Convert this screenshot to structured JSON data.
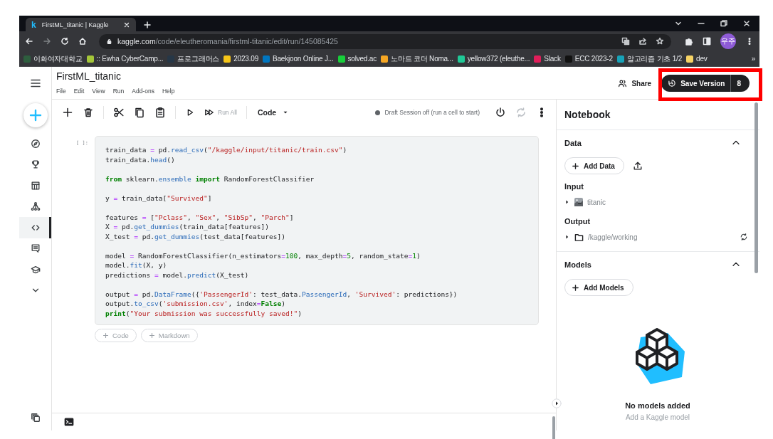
{
  "browser": {
    "tab": {
      "favicon": "k",
      "title": "FirstML_titanic | Kaggle"
    },
    "address": {
      "host": "kaggle.com",
      "path": "/code/eleutheromania/firstml-titanic/edit/run/145085425"
    },
    "profile": "우주",
    "bookmarks": [
      {
        "label": "이화여자대학교",
        "color": "#2e5e3e"
      },
      {
        "label": ":: Ewha CyberCamp...",
        "color": "#a4c639"
      },
      {
        "label": "프로그래머스",
        "color": "#263747"
      },
      {
        "label": "2023.09",
        "color": "#f5c518"
      },
      {
        "label": "Baekjoon Online J...",
        "color": "#0076c0"
      },
      {
        "label": "solved.ac",
        "color": "#17ce3a"
      },
      {
        "label": "노마드 코더 Noma...",
        "color": "#f5a623"
      },
      {
        "label": "yellow372 (eleuthe...",
        "color": "#20c997"
      },
      {
        "label": "Slack",
        "color": "#e01e5a"
      },
      {
        "label": "ECC 2023-2",
        "color": "#111111"
      },
      {
        "label": "알고리즘 기초 1/2",
        "color": "#17a2b8"
      },
      {
        "label": "dev",
        "color": "#f6d365"
      }
    ],
    "more": "»"
  },
  "header": {
    "title": "FirstML_titanic",
    "menu": [
      "File",
      "Edit",
      "View",
      "Run",
      "Add-ons",
      "Help"
    ],
    "share": "Share",
    "save_version": {
      "label": "Save Version",
      "count": "8",
      "highlighted": true
    }
  },
  "sidebar": {
    "items": [
      {
        "selected": false
      },
      {
        "selected": false
      },
      {
        "selected": false
      },
      {
        "selected": false
      },
      {
        "selected": true
      },
      {
        "selected": false
      },
      {
        "selected": false
      },
      {
        "selected": false
      }
    ]
  },
  "toolbar": {
    "run_all": "Run All",
    "cell_type": "Code",
    "session": {
      "text": "Draft Session off (run a cell to start)",
      "active": false
    }
  },
  "cell": {
    "prompt": "[ ]:",
    "blocks": [
      [
        [
          {
            "text": "train_data ",
            "kind": "plain"
          },
          {
            "text": "=",
            "kind": "op"
          },
          {
            "text": " pd.",
            "kind": "plain"
          },
          {
            "text": "read_csv",
            "kind": "fn"
          },
          {
            "text": "(",
            "kind": "plain"
          },
          {
            "text": "\"/kaggle/input/titanic/train.csv\"",
            "kind": "str"
          },
          {
            "text": ")",
            "kind": "plain"
          }
        ],
        [
          {
            "text": "train_data.",
            "kind": "plain"
          },
          {
            "text": "head",
            "kind": "fn"
          },
          {
            "text": "()",
            "kind": "plain"
          }
        ]
      ],
      [
        [
          {
            "text": "from",
            "kind": "kw"
          },
          {
            "text": " sklearn.",
            "kind": "plain"
          },
          {
            "text": "ensemble",
            "kind": "fn"
          },
          {
            "text": " import",
            "kind": "kw"
          },
          {
            "text": " RandomForestClassifier",
            "kind": "plain"
          }
        ]
      ],
      [
        [
          {
            "text": "y ",
            "kind": "plain"
          },
          {
            "text": "=",
            "kind": "op"
          },
          {
            "text": " train_data[",
            "kind": "plain"
          },
          {
            "text": "\"Survived\"",
            "kind": "str"
          },
          {
            "text": "]",
            "kind": "plain"
          }
        ]
      ],
      [
        [
          {
            "text": "features ",
            "kind": "plain"
          },
          {
            "text": "=",
            "kind": "op"
          },
          {
            "text": " [",
            "kind": "plain"
          },
          {
            "text": "\"Pclass\"",
            "kind": "str"
          },
          {
            "text": ", ",
            "kind": "plain"
          },
          {
            "text": "\"Sex\"",
            "kind": "str"
          },
          {
            "text": ", ",
            "kind": "plain"
          },
          {
            "text": "\"SibSp\"",
            "kind": "str"
          },
          {
            "text": ", ",
            "kind": "plain"
          },
          {
            "text": "\"Parch\"",
            "kind": "str"
          },
          {
            "text": "]",
            "kind": "plain"
          }
        ],
        [
          {
            "text": "X ",
            "kind": "plain"
          },
          {
            "text": "=",
            "kind": "op"
          },
          {
            "text": " pd.",
            "kind": "plain"
          },
          {
            "text": "get_dummies",
            "kind": "fn"
          },
          {
            "text": "(train_data[features])",
            "kind": "plain"
          }
        ],
        [
          {
            "text": "X_test ",
            "kind": "plain"
          },
          {
            "text": "=",
            "kind": "op"
          },
          {
            "text": " pd.",
            "kind": "plain"
          },
          {
            "text": "get_dummies",
            "kind": "fn"
          },
          {
            "text": "(test_data[features])",
            "kind": "plain"
          }
        ]
      ],
      [
        [
          {
            "text": "model ",
            "kind": "plain"
          },
          {
            "text": "=",
            "kind": "op"
          },
          {
            "text": " RandomForestClassifier(n_estimators",
            "kind": "plain"
          },
          {
            "text": "=",
            "kind": "op"
          },
          {
            "text": "100",
            "kind": "num"
          },
          {
            "text": ", max_depth",
            "kind": "plain"
          },
          {
            "text": "=",
            "kind": "op"
          },
          {
            "text": "5",
            "kind": "num"
          },
          {
            "text": ", random_state",
            "kind": "plain"
          },
          {
            "text": "=",
            "kind": "op"
          },
          {
            "text": "1",
            "kind": "num"
          },
          {
            "text": ")",
            "kind": "plain"
          }
        ],
        [
          {
            "text": "model.",
            "kind": "plain"
          },
          {
            "text": "fit",
            "kind": "fn"
          },
          {
            "text": "(X, y)",
            "kind": "plain"
          }
        ],
        [
          {
            "text": "predictions ",
            "kind": "plain"
          },
          {
            "text": "=",
            "kind": "op"
          },
          {
            "text": " model.",
            "kind": "plain"
          },
          {
            "text": "predict",
            "kind": "fn"
          },
          {
            "text": "(X_test)",
            "kind": "plain"
          }
        ]
      ],
      [
        [
          {
            "text": "output ",
            "kind": "plain"
          },
          {
            "text": "=",
            "kind": "op"
          },
          {
            "text": " pd.",
            "kind": "plain"
          },
          {
            "text": "DataFrame",
            "kind": "fn"
          },
          {
            "text": "({",
            "kind": "plain"
          },
          {
            "text": "'PassengerId'",
            "kind": "str"
          },
          {
            "text": ": test_data.",
            "kind": "plain"
          },
          {
            "text": "PassengerId",
            "kind": "fn"
          },
          {
            "text": ", ",
            "kind": "plain"
          },
          {
            "text": "'Survived'",
            "kind": "str"
          },
          {
            "text": ": predictions})",
            "kind": "plain"
          }
        ],
        [
          {
            "text": "output.",
            "kind": "plain"
          },
          {
            "text": "to_csv",
            "kind": "fn"
          },
          {
            "text": "(",
            "kind": "plain"
          },
          {
            "text": "'submission.csv'",
            "kind": "str"
          },
          {
            "text": ", index",
            "kind": "plain"
          },
          {
            "text": "=",
            "kind": "op"
          },
          {
            "text": "False",
            "kind": "kw"
          },
          {
            "text": ")",
            "kind": "plain"
          }
        ],
        [
          {
            "text": "print",
            "kind": "kw"
          },
          {
            "text": "(",
            "kind": "plain"
          },
          {
            "text": "\"Your submission was successfully saved!\"",
            "kind": "str"
          },
          {
            "text": ")",
            "kind": "plain"
          }
        ]
      ]
    ]
  },
  "add_cell": [
    "Code",
    "Markdown"
  ],
  "panel": {
    "title": "Notebook",
    "data": {
      "title": "Data",
      "expanded": true,
      "button": "Add Data",
      "input": {
        "title": "Input",
        "items": [
          {
            "label": "titanic",
            "expanded": false
          }
        ]
      },
      "output": {
        "title": "Output",
        "items": [
          {
            "label": "/kaggle/working",
            "expanded": false
          }
        ]
      }
    },
    "models": {
      "title": "Models",
      "expanded": true,
      "button": "Add Models",
      "empty_title": "No models added",
      "empty_text": "Add a Kaggle model"
    }
  }
}
